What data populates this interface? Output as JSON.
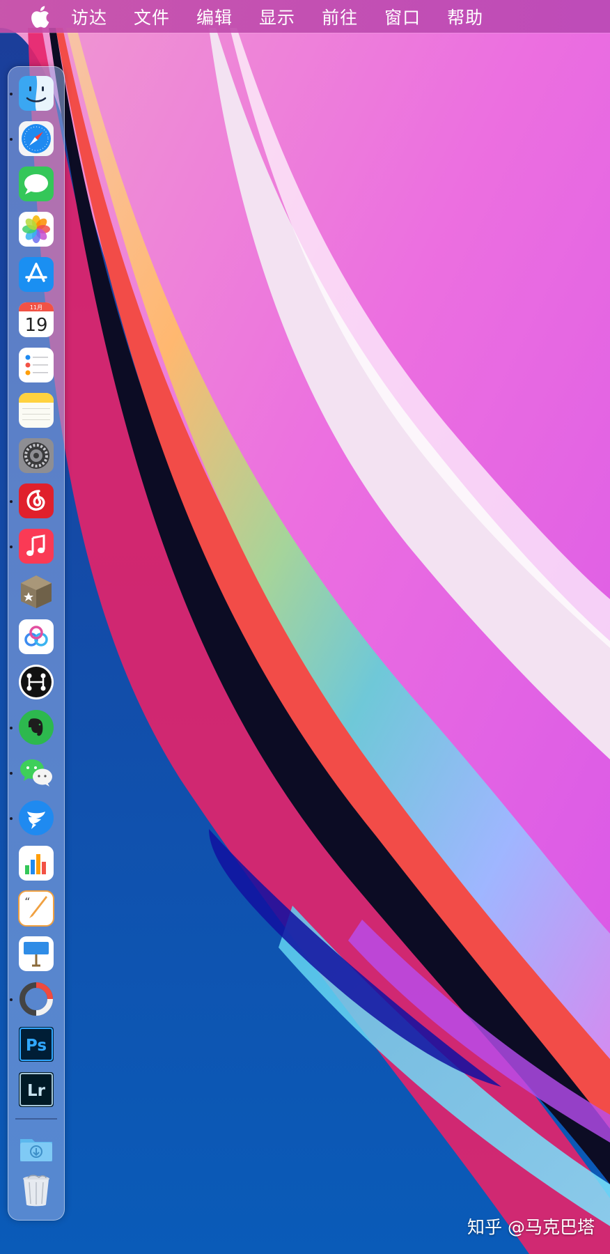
{
  "menubar": {
    "apple_icon": "apple-logo-icon",
    "items": [
      "访达",
      "文件",
      "编辑",
      "显示",
      "前往",
      "窗口",
      "帮助"
    ]
  },
  "dock": {
    "apps": [
      {
        "name": "finder",
        "icon": "finder-icon",
        "running": true
      },
      {
        "name": "safari",
        "icon": "safari-icon",
        "running": true
      },
      {
        "name": "messages",
        "icon": "messages-icon",
        "running": false
      },
      {
        "name": "photos",
        "icon": "photos-icon",
        "running": false
      },
      {
        "name": "app-store",
        "icon": "app-store-icon",
        "running": false
      },
      {
        "name": "calendar",
        "icon": "calendar-icon",
        "running": false,
        "month": "11月",
        "day": "19"
      },
      {
        "name": "reminders",
        "icon": "reminders-icon",
        "running": false
      },
      {
        "name": "notes",
        "icon": "notes-icon",
        "running": false
      },
      {
        "name": "system-preferences",
        "icon": "gear-icon",
        "running": false
      },
      {
        "name": "netease-music",
        "icon": "netease-music-icon",
        "running": true
      },
      {
        "name": "music",
        "icon": "music-icon",
        "running": true
      },
      {
        "name": "box-app",
        "icon": "star-box-icon",
        "running": false
      },
      {
        "name": "baidu-netdisk",
        "icon": "cloud-icon",
        "running": false
      },
      {
        "name": "mindnode",
        "icon": "mindmap-icon",
        "running": false
      },
      {
        "name": "evernote",
        "icon": "evernote-icon",
        "running": true
      },
      {
        "name": "wechat",
        "icon": "wechat-icon",
        "running": true
      },
      {
        "name": "dingtalk",
        "icon": "dingtalk-icon",
        "running": true
      },
      {
        "name": "numbers",
        "icon": "numbers-icon",
        "running": false
      },
      {
        "name": "pages",
        "icon": "pages-icon",
        "running": false
      },
      {
        "name": "keynote",
        "icon": "keynote-icon",
        "running": false
      },
      {
        "name": "istat-menus",
        "icon": "ring-icon",
        "running": true
      },
      {
        "name": "photoshop",
        "icon": "photoshop-icon",
        "running": false,
        "label": "Ps"
      },
      {
        "name": "lightroom",
        "icon": "lightroom-icon",
        "running": false,
        "label": "Lr"
      }
    ],
    "downloads_icon": "downloads-folder-icon",
    "trash_icon": "trash-icon"
  },
  "watermark": "知乎 @马克巴塔"
}
